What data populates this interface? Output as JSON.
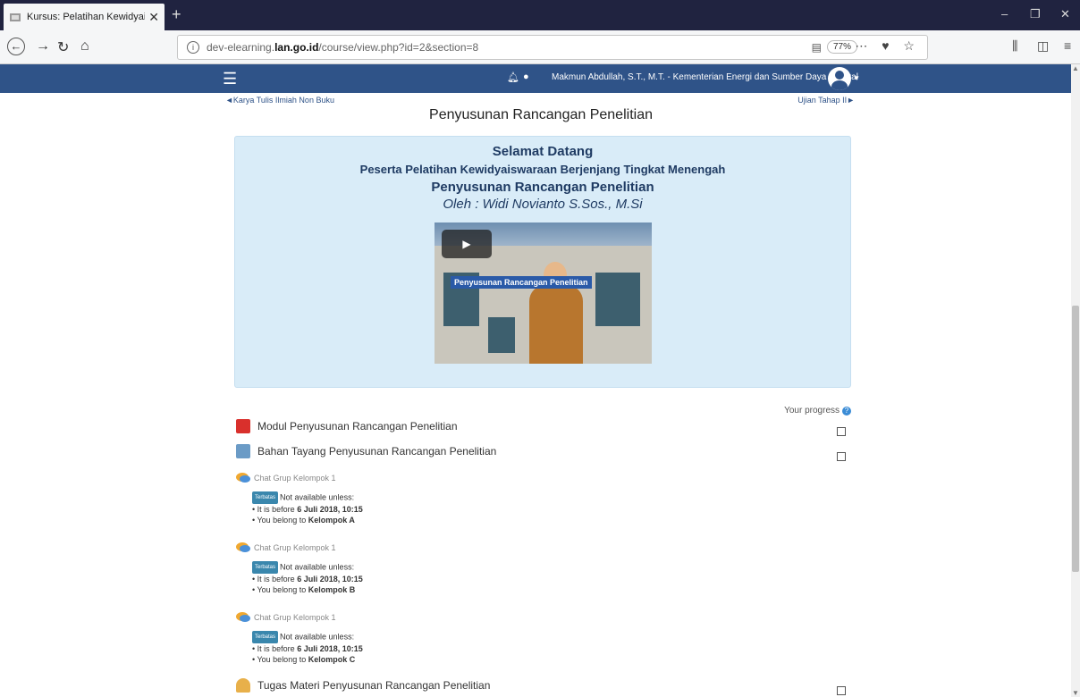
{
  "browser": {
    "tab_title": "Kursus: Pelatihan Kewidyaiswar",
    "url_prefix": "dev-elearning.",
    "url_domain": "lan.go.id",
    "url_path": "/course/view.php?id=2&section=8",
    "zoom": "77%"
  },
  "header": {
    "user_label": "Makmun Abdullah, S.T., M.T. - Kementerian Energi dan Sumber Daya Mineral"
  },
  "section": {
    "prev_link": "◄Karya Tulis Ilmiah Non Buku",
    "next_link": "Ujian Tahap II►",
    "title": "Penyusunan Rancangan Penelitian"
  },
  "welcome": {
    "line1": "Selamat Datang",
    "line2": "Peserta Pelatihan Kewidyaiswaraan Berjenjang Tingkat Menengah",
    "line3": "Penyusunan Rancangan Penelitian",
    "line4": "Oleh : Widi Novianto S.Sos., M.Si",
    "video_label": "Penyusunan Rancangan Penelitian"
  },
  "progress_label": "Your progress",
  "activities": [
    {
      "label": "Modul Penyusunan Rancangan Penelitian"
    },
    {
      "label": "Bahan Tayang Penyusunan Rancangan Penelitian"
    },
    {
      "label": "Tugas Materi Penyusunan Rancangan Penelitian"
    }
  ],
  "chats": [
    {
      "label": "Chat Grup Kelompok 1",
      "group": "Kelompok A"
    },
    {
      "label": "Chat Grup Kelompok 1",
      "group": "Kelompok B"
    },
    {
      "label": "Chat Grup Kelompok 1",
      "group": "Kelompok C"
    }
  ],
  "restriction": {
    "badge": "Terbatas",
    "not_available": "Not available unless:",
    "before_prefix": "• It is before ",
    "before_date": "6 Juli 2018, 10:15",
    "belong_prefix": "• You belong to "
  }
}
